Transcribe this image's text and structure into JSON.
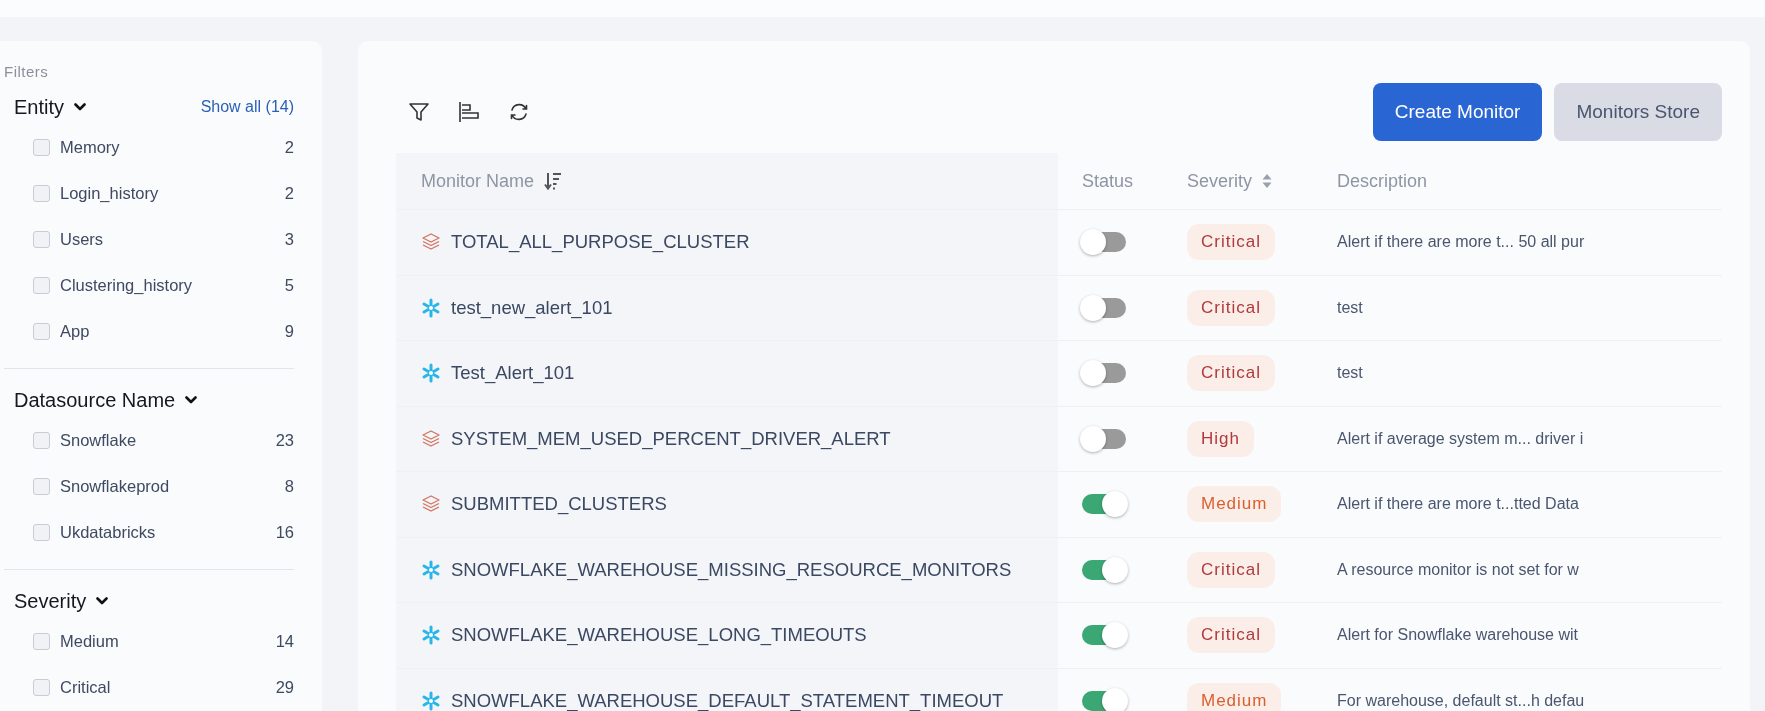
{
  "filters": {
    "title": "Filters",
    "groups": [
      {
        "title": "Entity",
        "show_all": "Show all (14)",
        "items": [
          {
            "label": "Memory",
            "count": "2",
            "checked": false
          },
          {
            "label": "Login_history",
            "count": "2",
            "checked": false
          },
          {
            "label": "Users",
            "count": "3",
            "checked": false
          },
          {
            "label": "Clustering_history",
            "count": "5",
            "checked": false
          },
          {
            "label": "App",
            "count": "9",
            "checked": false
          }
        ]
      },
      {
        "title": "Datasource Name",
        "items": [
          {
            "label": "Snowflake",
            "count": "23",
            "checked": false
          },
          {
            "label": "Snowflakeprod",
            "count": "8",
            "checked": false
          },
          {
            "label": "Ukdatabricks",
            "count": "16",
            "checked": false
          }
        ]
      },
      {
        "title": "Severity",
        "items": [
          {
            "label": "Medium",
            "count": "14",
            "checked": false
          },
          {
            "label": "Critical",
            "count": "29",
            "checked": false
          }
        ]
      }
    ]
  },
  "actions": {
    "create": "Create Monitor",
    "store": "Monitors Store"
  },
  "table": {
    "columns": [
      "Monitor Name",
      "Status",
      "Severity",
      "Description"
    ],
    "rows": [
      {
        "kind": "databricks",
        "name": "TOTAL_ALL_PURPOSE_CLUSTER",
        "on": false,
        "severity": "Critical",
        "color": "#b0393b",
        "description": "Alert if there are more t... 50 all pur"
      },
      {
        "kind": "snowflake",
        "name": "test_new_alert_101",
        "on": false,
        "severity": "Critical",
        "color": "#b0393b",
        "description": "test"
      },
      {
        "kind": "snowflake",
        "name": "Test_Alert_101",
        "on": false,
        "severity": "Critical",
        "color": "#b0393b",
        "description": "test"
      },
      {
        "kind": "databricks",
        "name": "SYSTEM_MEM_USED_PERCENT_DRIVER_ALERT",
        "on": false,
        "severity": "High",
        "color": "#b0393b",
        "description": "Alert if average system m... driver i"
      },
      {
        "kind": "databricks",
        "name": "SUBMITTED_CLUSTERS",
        "on": true,
        "severity": "Medium",
        "color": "#d9602e",
        "description": "Alert if there are more t...tted Data"
      },
      {
        "kind": "snowflake",
        "name": "SNOWFLAKE_WAREHOUSE_MISSING_RESOURCE_MONITORS",
        "on": true,
        "severity": "Critical",
        "color": "#b0393b",
        "description": "A resource monitor is not set for w"
      },
      {
        "kind": "snowflake",
        "name": "SNOWFLAKE_WAREHOUSE_LONG_TIMEOUTS",
        "on": true,
        "severity": "Critical",
        "color": "#b0393b",
        "description": "Alert for Snowflake warehouse wit"
      },
      {
        "kind": "snowflake",
        "name": "SNOWFLAKE_WAREHOUSE_DEFAULT_STATEMENT_TIMEOUT",
        "on": true,
        "severity": "Medium",
        "color": "#d9602e",
        "description": "For warehouse, default st...h defau"
      }
    ]
  }
}
